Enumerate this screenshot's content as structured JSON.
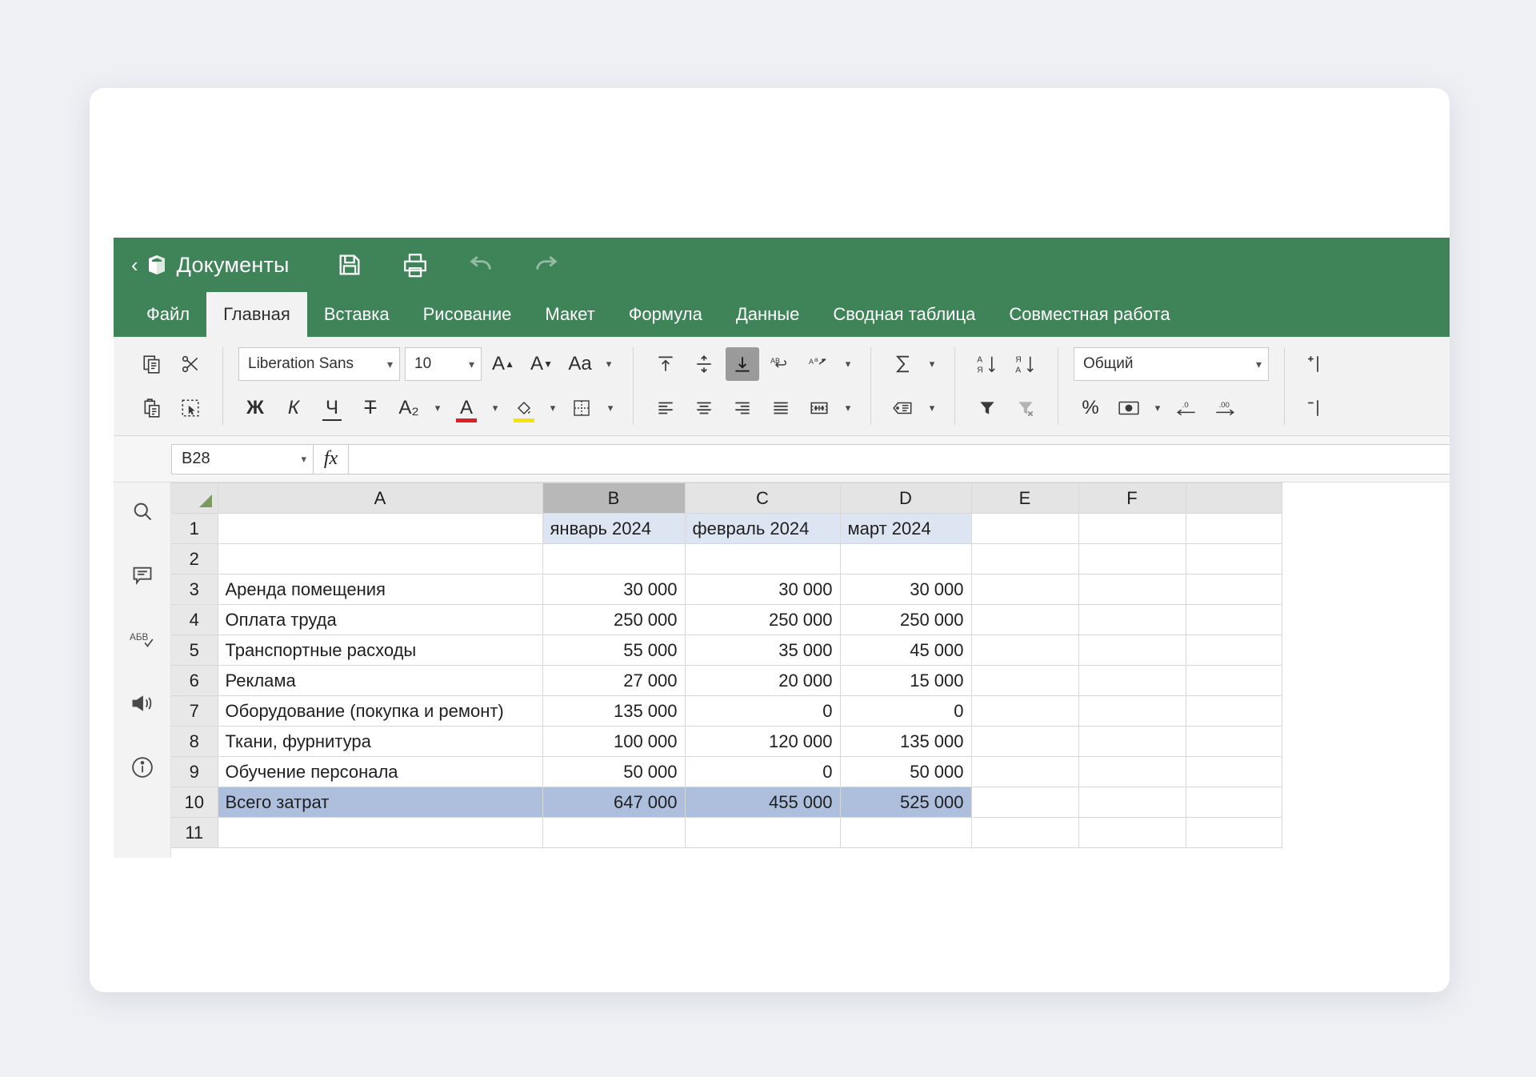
{
  "titlebar": {
    "back_label": "‹",
    "app_title": "Документы",
    "logo_icon": "documents-cube-logo",
    "actions": [
      {
        "icon": "save-icon",
        "name": "save-button"
      },
      {
        "icon": "print-icon",
        "name": "print-button"
      },
      {
        "icon": "undo-icon",
        "name": "undo-button"
      },
      {
        "icon": "redo-icon",
        "name": "redo-button"
      }
    ]
  },
  "tabs": [
    {
      "label": "Файл",
      "active": false
    },
    {
      "label": "Главная",
      "active": true
    },
    {
      "label": "Вставка",
      "active": false
    },
    {
      "label": "Рисование",
      "active": false
    },
    {
      "label": "Макет",
      "active": false
    },
    {
      "label": "Формула",
      "active": false
    },
    {
      "label": "Данные",
      "active": false
    },
    {
      "label": "Сводная таблица",
      "active": false
    },
    {
      "label": "Совместная работа",
      "active": false
    }
  ],
  "ribbon": {
    "clipboard": {
      "copy_icon": "copy-icon",
      "cut_icon": "scissors-cut-icon",
      "paste_icon": "paste-icon",
      "select_icon": "select-objects-icon"
    },
    "font": {
      "family_value": "Liberation Sans",
      "size_value": "10",
      "grow_icon": "increase-font-size-icon",
      "shrink_icon": "decrease-font-size-icon",
      "case_icon": "change-case-icon",
      "bold_label": "Ж",
      "italic_label": "К",
      "underline_label": "Ч",
      "strike_label": "Т",
      "subscript_label": "A₂",
      "font_color_label": "A",
      "font_color": "#e02020",
      "highlight_icon": "fill-color-icon",
      "highlight_color": "#f5e400",
      "borders_icon": "borders-icon"
    },
    "alignment": {
      "align_top_icon": "align-top-icon",
      "align_middle_icon": "align-middle-icon",
      "align_bottom_icon": "align-bottom-icon",
      "wrap_text_icon": "wrap-text-icon",
      "text_orientation_icon": "text-orientation-icon",
      "align_left_icon": "align-left-icon",
      "align_center_icon": "align-center-icon",
      "align_right_icon": "align-right-icon",
      "align_justify_icon": "align-justify-icon",
      "merge_cells_icon": "merge-cells-icon"
    },
    "functions": {
      "autosum_icon": "autosum-sigma-icon",
      "named_range_icon": "named-range-icon"
    },
    "sorting": {
      "sort_az_icon": "sort-ascending-icon",
      "sort_za_icon": "sort-descending-icon",
      "filter_icon": "filter-icon",
      "clear_filter_icon": "clear-filter-icon"
    },
    "number": {
      "format_value": "Общий",
      "percent_label": "%",
      "currency_icon": "currency-icon",
      "decrease_decimal_label": ".0",
      "increase_decimal_label": ".00"
    },
    "cells": {
      "insert_row_icon": "insert-cells-icon",
      "delete_row_icon": "delete-cells-icon"
    }
  },
  "formula_bar": {
    "cell_reference": "B28",
    "fx_label": "fx",
    "formula_value": ""
  },
  "sidebar": {
    "items": [
      {
        "icon": "search-icon",
        "name": "sidebar-item-search"
      },
      {
        "icon": "comment-icon",
        "name": "sidebar-item-comments"
      },
      {
        "icon": "spellcheck-icon",
        "name": "sidebar-item-spellcheck"
      },
      {
        "icon": "announcement-icon",
        "name": "sidebar-item-announcements"
      },
      {
        "icon": "info-icon",
        "name": "sidebar-item-about"
      }
    ]
  },
  "spreadsheet": {
    "selected_cell": "B28",
    "selected_column": "B",
    "column_headers": [
      "A",
      "B",
      "C",
      "D",
      "E",
      "F"
    ],
    "row_numbers": [
      "1",
      "2",
      "3",
      "4",
      "5",
      "6",
      "7",
      "8",
      "9",
      "10",
      "11"
    ],
    "rows": [
      {
        "n": "1",
        "label": "",
        "b": "январь 2024",
        "c": "февраль 2024",
        "d": "март 2024",
        "style": "header"
      },
      {
        "n": "2",
        "label": "",
        "b": "",
        "c": "",
        "d": "",
        "style": "blank"
      },
      {
        "n": "3",
        "label": "Аренда помещения",
        "b": "30 000",
        "c": "30 000",
        "d": "30 000",
        "style": "data"
      },
      {
        "n": "4",
        "label": "Оплата труда",
        "b": "250 000",
        "c": "250 000",
        "d": "250 000",
        "style": "data"
      },
      {
        "n": "5",
        "label": "Транспортные расходы",
        "b": "55 000",
        "c": "35 000",
        "d": "45 000",
        "style": "data"
      },
      {
        "n": "6",
        "label": "Реклама",
        "b": "27 000",
        "c": "20 000",
        "d": "15 000",
        "style": "data"
      },
      {
        "n": "7",
        "label": "Оборудование (покупка и ремонт)",
        "b": "135 000",
        "c": "0",
        "d": "0",
        "style": "data"
      },
      {
        "n": "8",
        "label": "Ткани, фурнитура",
        "b": "100 000",
        "c": "120 000",
        "d": "135 000",
        "style": "data"
      },
      {
        "n": "9",
        "label": "Обучение персонала",
        "b": "50 000",
        "c": "0",
        "d": "50 000",
        "style": "data"
      },
      {
        "n": "10",
        "label": "Всего затрат",
        "b": "647 000",
        "c": "455 000",
        "d": "525 000",
        "style": "total"
      },
      {
        "n": "11",
        "label": "",
        "b": "",
        "c": "",
        "d": "",
        "style": "blank"
      }
    ]
  },
  "colors": {
    "brand_green": "#3f8459",
    "header_blue": "#dde5f3",
    "total_blue": "#adbfdd",
    "selected_col_gray": "#b8b8b8"
  }
}
